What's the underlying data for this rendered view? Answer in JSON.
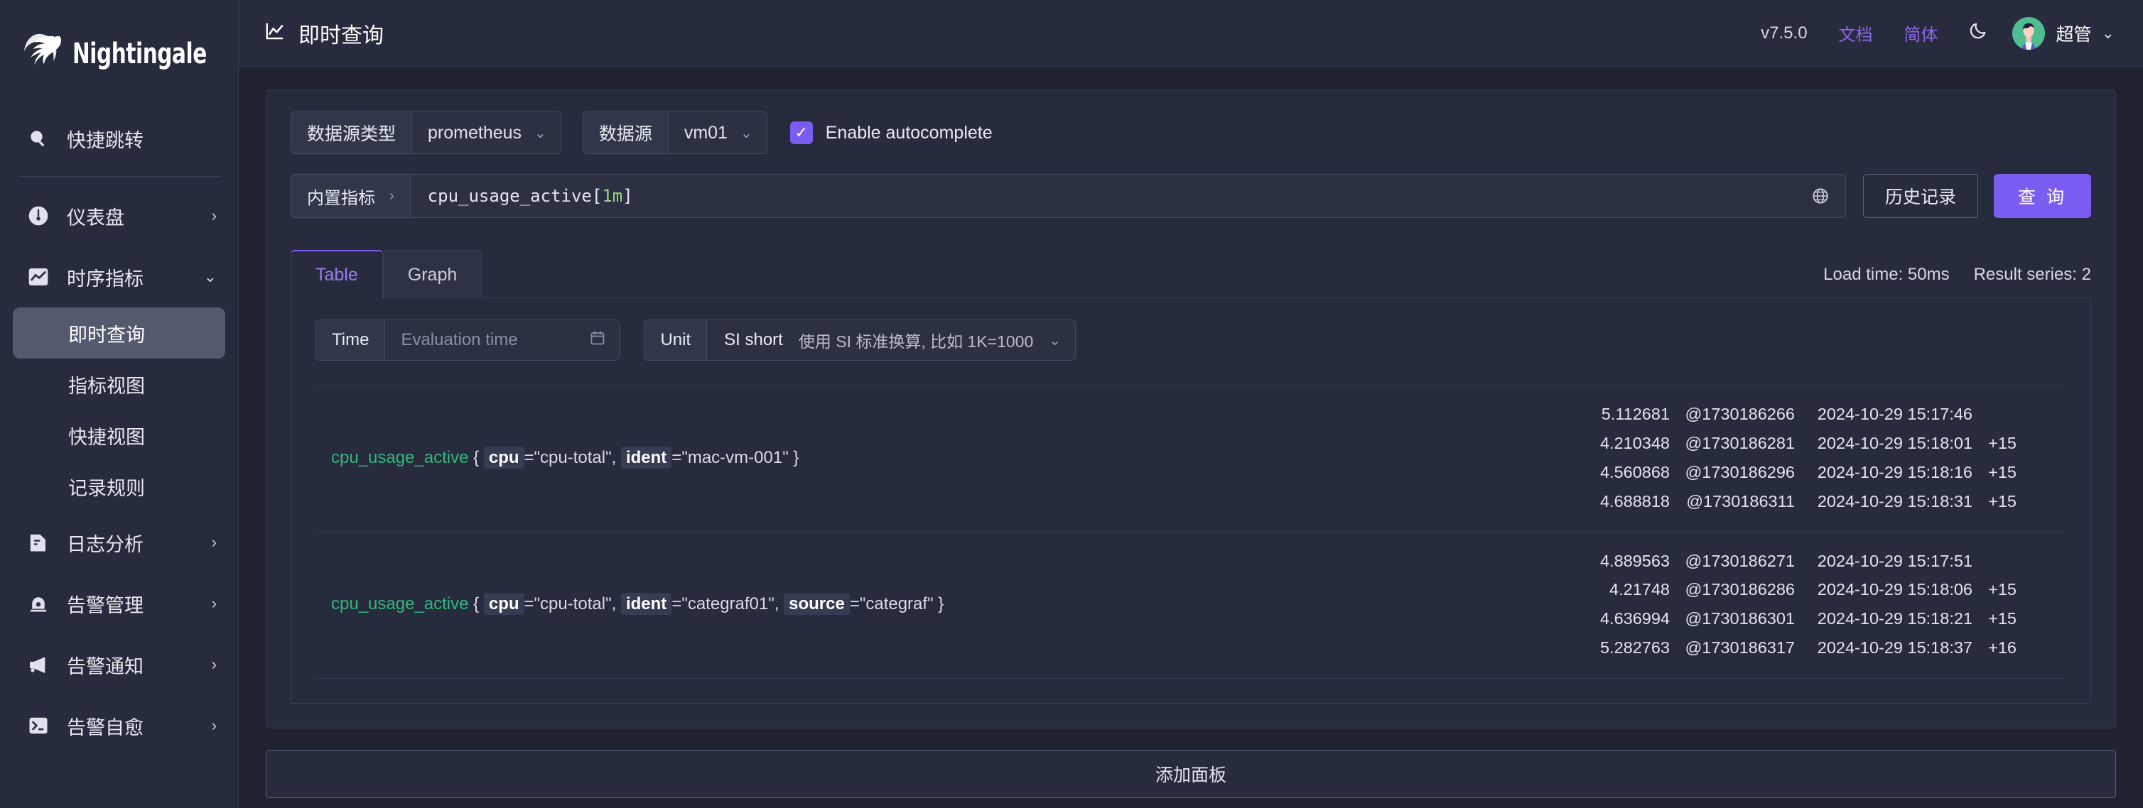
{
  "brand": {
    "name": "Nightingale",
    "logo_icon": "bird-logo-icon"
  },
  "sidebar": {
    "quick_jump": {
      "label": "快捷跳转",
      "icon": "search-icon"
    },
    "items": [
      {
        "label": "仪表盘",
        "icon": "dashboard-gauge-icon",
        "chevron": "›"
      },
      {
        "label": "时序指标",
        "icon": "line-chart-icon",
        "chevron": "⌄"
      }
    ],
    "sub_items": [
      {
        "label": "即时查询",
        "active": true
      },
      {
        "label": "指标视图",
        "active": false
      },
      {
        "label": "快捷视图",
        "active": false
      },
      {
        "label": "记录规则",
        "active": false
      }
    ],
    "lower_items": [
      {
        "label": "日志分析",
        "icon": "document-log-icon",
        "chevron": "›"
      },
      {
        "label": "告警管理",
        "icon": "alarm-bell-icon",
        "chevron": "›"
      },
      {
        "label": "告警通知",
        "icon": "megaphone-icon",
        "chevron": "›"
      },
      {
        "label": "告警自愈",
        "icon": "terminal-icon",
        "chevron": "›"
      }
    ]
  },
  "topbar": {
    "title": "即时查询",
    "title_icon": "line-chart-icon",
    "version": "v7.5.0",
    "docs_link": "文档",
    "lang_link": "简体",
    "theme_toggle_icon": "moon-icon",
    "avatar_icon": "user-avatar",
    "user_name": "超管",
    "user_caret": "⌄"
  },
  "query": {
    "datasource_type_label": "数据源类型",
    "datasource_type_value": "prometheus",
    "datasource_label": "数据源",
    "datasource_value": "vm01",
    "autocomplete_label": "Enable autocomplete",
    "autocomplete_checked": true,
    "builtin_metrics_label": "内置指标",
    "builtin_metrics_chevron": "›",
    "expression": "cpu_usage_active[",
    "expression_duration": "1m",
    "expression_tail": "]",
    "globe_icon": "globe-icon",
    "history_button": "历史记录",
    "run_button": "查 询"
  },
  "tabs": {
    "items": [
      {
        "label": "Table",
        "active": true
      },
      {
        "label": "Graph",
        "active": false
      }
    ],
    "load_time": "Load time: 50ms",
    "result_series": "Result series: 2"
  },
  "controls": {
    "time_label": "Time",
    "time_placeholder": "Evaluation time",
    "calendar_icon": "calendar-icon",
    "unit_label": "Unit",
    "unit_value": "SI short",
    "unit_description": "使用 SI 标准换算, 比如 1K=1000",
    "unit_caret": "⌄"
  },
  "results": [
    {
      "metric": "cpu_usage_active",
      "labels": [
        {
          "key": "cpu",
          "value": "\"cpu-total\""
        },
        {
          "key": "ident",
          "value": "\"mac-vm-001\""
        }
      ],
      "samples": [
        {
          "value": "5.112681",
          "ts": "@1730186266",
          "datetime": "2024-10-29 15:17:46",
          "delta": ""
        },
        {
          "value": "4.210348",
          "ts": "@1730186281",
          "datetime": "2024-10-29 15:18:01",
          "delta": "+15"
        },
        {
          "value": "4.560868",
          "ts": "@1730186296",
          "datetime": "2024-10-29 15:18:16",
          "delta": "+15"
        },
        {
          "value": "4.688818",
          "ts": "@1730186311",
          "datetime": "2024-10-29 15:18:31",
          "delta": "+15"
        }
      ]
    },
    {
      "metric": "cpu_usage_active",
      "labels": [
        {
          "key": "cpu",
          "value": "\"cpu-total\""
        },
        {
          "key": "ident",
          "value": "\"categraf01\""
        },
        {
          "key": "source",
          "value": "\"categraf\""
        }
      ],
      "samples": [
        {
          "value": "4.889563",
          "ts": "@1730186271",
          "datetime": "2024-10-29 15:17:51",
          "delta": ""
        },
        {
          "value": "4.21748",
          "ts": "@1730186286",
          "datetime": "2024-10-29 15:18:06",
          "delta": "+15"
        },
        {
          "value": "4.636994",
          "ts": "@1730186301",
          "datetime": "2024-10-29 15:18:21",
          "delta": "+15"
        },
        {
          "value": "5.282763",
          "ts": "@1730186317",
          "datetime": "2024-10-29 15:18:37",
          "delta": "+16"
        }
      ]
    }
  ],
  "footer": {
    "add_panel_label": "添加面板"
  },
  "colors": {
    "accent": "#7b5cf0",
    "link": "#8b67e8",
    "metric_green": "#35b57a",
    "duration_green": "#9ad67f",
    "sidebar_bg": "#262b3d",
    "page_bg": "#20232f"
  }
}
